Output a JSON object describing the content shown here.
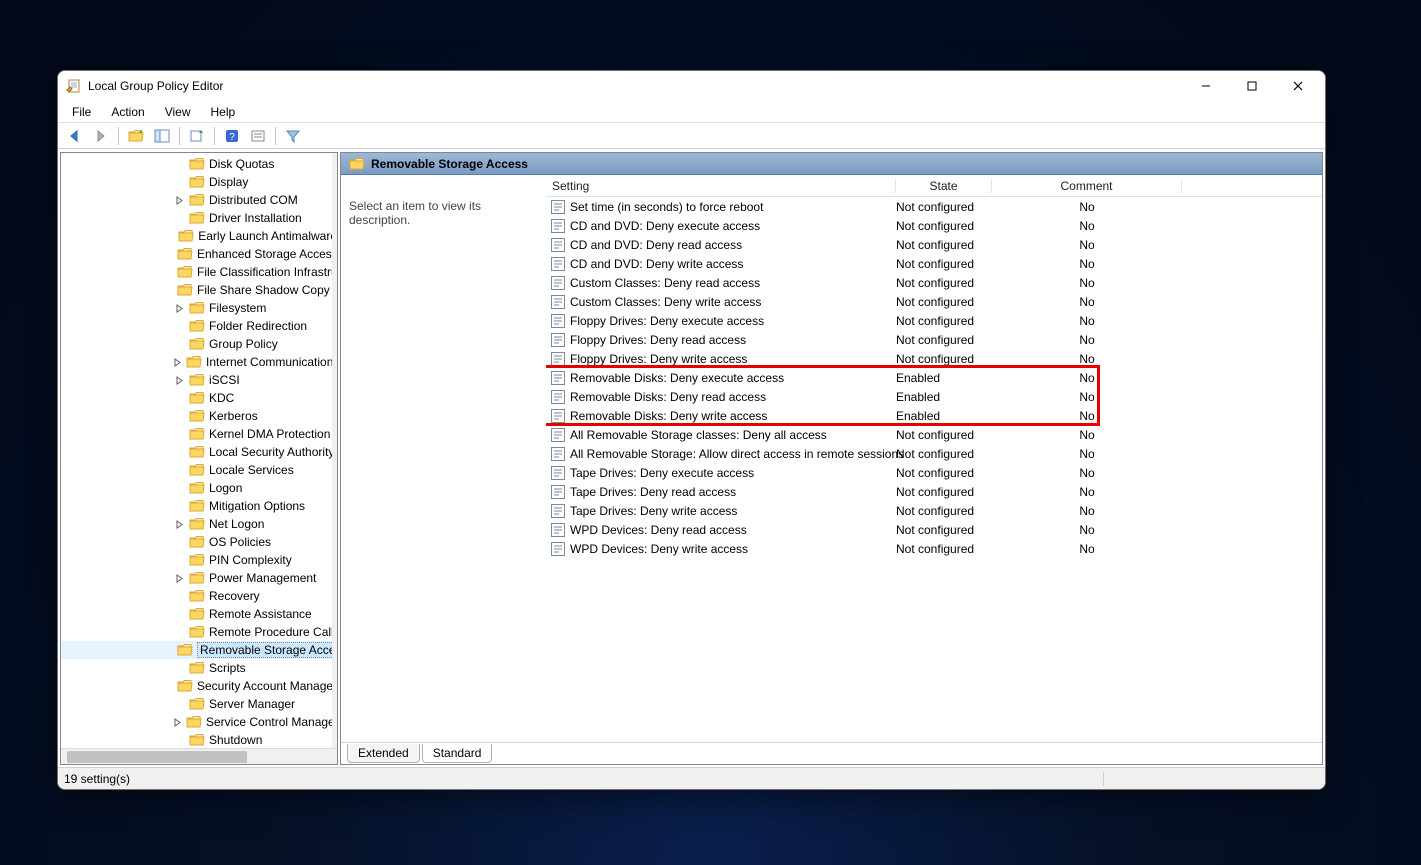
{
  "window": {
    "title": "Local Group Policy Editor"
  },
  "menus": {
    "file": "File",
    "action": "Action",
    "view": "View",
    "help": "Help"
  },
  "tree": {
    "items": [
      {
        "label": "Disk Quotas",
        "expandable": false
      },
      {
        "label": "Display",
        "expandable": false
      },
      {
        "label": "Distributed COM",
        "expandable": true
      },
      {
        "label": "Driver Installation",
        "expandable": false
      },
      {
        "label": "Early Launch Antimalware",
        "expandable": false
      },
      {
        "label": "Enhanced Storage Access",
        "expandable": false
      },
      {
        "label": "File Classification Infrastructure",
        "expandable": false
      },
      {
        "label": "File Share Shadow Copy Provider",
        "expandable": false
      },
      {
        "label": "Filesystem",
        "expandable": true
      },
      {
        "label": "Folder Redirection",
        "expandable": false
      },
      {
        "label": "Group Policy",
        "expandable": false
      },
      {
        "label": "Internet Communication Management",
        "expandable": true
      },
      {
        "label": "iSCSI",
        "expandable": true
      },
      {
        "label": "KDC",
        "expandable": false
      },
      {
        "label": "Kerberos",
        "expandable": false
      },
      {
        "label": "Kernel DMA Protection",
        "expandable": false
      },
      {
        "label": "Local Security Authority",
        "expandable": false
      },
      {
        "label": "Locale Services",
        "expandable": false
      },
      {
        "label": "Logon",
        "expandable": false
      },
      {
        "label": "Mitigation Options",
        "expandable": false
      },
      {
        "label": "Net Logon",
        "expandable": true
      },
      {
        "label": "OS Policies",
        "expandable": false
      },
      {
        "label": "PIN Complexity",
        "expandable": false
      },
      {
        "label": "Power Management",
        "expandable": true
      },
      {
        "label": "Recovery",
        "expandable": false
      },
      {
        "label": "Remote Assistance",
        "expandable": false
      },
      {
        "label": "Remote Procedure Call",
        "expandable": false
      },
      {
        "label": "Removable Storage Access",
        "expandable": false,
        "selected": true
      },
      {
        "label": "Scripts",
        "expandable": false
      },
      {
        "label": "Security Account Manager",
        "expandable": false
      },
      {
        "label": "Server Manager",
        "expandable": false
      },
      {
        "label": "Service Control Manager Settings",
        "expandable": true
      },
      {
        "label": "Shutdown",
        "expandable": false
      }
    ]
  },
  "breadcrumb": {
    "title": "Removable Storage Access"
  },
  "description": "Select an item to view its description.",
  "columns": {
    "setting": "Setting",
    "state": "State",
    "comment": "Comment"
  },
  "settings": [
    {
      "name": "Set time (in seconds) to force reboot",
      "state": "Not configured",
      "comment": "No"
    },
    {
      "name": "CD and DVD: Deny execute access",
      "state": "Not configured",
      "comment": "No"
    },
    {
      "name": "CD and DVD: Deny read access",
      "state": "Not configured",
      "comment": "No"
    },
    {
      "name": "CD and DVD: Deny write access",
      "state": "Not configured",
      "comment": "No"
    },
    {
      "name": "Custom Classes: Deny read access",
      "state": "Not configured",
      "comment": "No"
    },
    {
      "name": "Custom Classes: Deny write access",
      "state": "Not configured",
      "comment": "No"
    },
    {
      "name": "Floppy Drives: Deny execute access",
      "state": "Not configured",
      "comment": "No"
    },
    {
      "name": "Floppy Drives: Deny read access",
      "state": "Not configured",
      "comment": "No"
    },
    {
      "name": "Floppy Drives: Deny write access",
      "state": "Not configured",
      "comment": "No"
    },
    {
      "name": "Removable Disks: Deny execute access",
      "state": "Enabled",
      "comment": "No",
      "hl": true
    },
    {
      "name": "Removable Disks: Deny read access",
      "state": "Enabled",
      "comment": "No",
      "hl": true
    },
    {
      "name": "Removable Disks: Deny write access",
      "state": "Enabled",
      "comment": "No",
      "hl": true
    },
    {
      "name": "All Removable Storage classes: Deny all access",
      "state": "Not configured",
      "comment": "No"
    },
    {
      "name": "All Removable Storage: Allow direct access in remote sessions",
      "state": "Not configured",
      "comment": "No"
    },
    {
      "name": "Tape Drives: Deny execute access",
      "state": "Not configured",
      "comment": "No"
    },
    {
      "name": "Tape Drives: Deny read access",
      "state": "Not configured",
      "comment": "No"
    },
    {
      "name": "Tape Drives: Deny write access",
      "state": "Not configured",
      "comment": "No"
    },
    {
      "name": "WPD Devices: Deny read access",
      "state": "Not configured",
      "comment": "No"
    },
    {
      "name": "WPD Devices: Deny write access",
      "state": "Not configured",
      "comment": "No"
    }
  ],
  "tabs": {
    "extended": "Extended",
    "standard": "Standard"
  },
  "status": "19 setting(s)"
}
